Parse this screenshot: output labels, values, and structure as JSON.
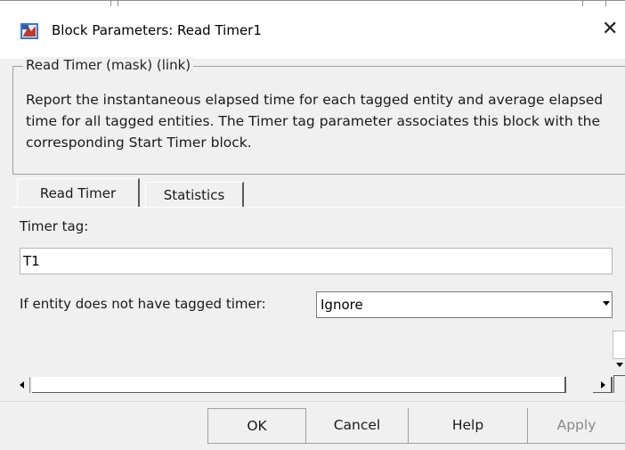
{
  "window": {
    "title": "Block Parameters: Read Timer1",
    "app_icon": "simulink-block-icon",
    "close_glyph": "✕"
  },
  "mask": {
    "group_label": "Read Timer (mask) (link)",
    "description": "Report the instantaneous elapsed time for each tagged entity and average elapsed time for all tagged entities. The Timer tag parameter associates this block with the corresponding Start Timer block."
  },
  "tabs": [
    {
      "label": "Read Timer",
      "active": true
    },
    {
      "label": "Statistics",
      "active": false
    }
  ],
  "params": {
    "timer_tag_label": "Timer tag:",
    "timer_tag_value": "T1",
    "untagged_label": "If entity does not have tagged timer:",
    "untagged_value": "Ignore"
  },
  "buttons": {
    "ok": "OK",
    "cancel": "Cancel",
    "help": "Help",
    "apply": "Apply"
  },
  "colors": {
    "dialog_bg": "#f0f0f0",
    "disabled_text": "#8a8a8a"
  }
}
